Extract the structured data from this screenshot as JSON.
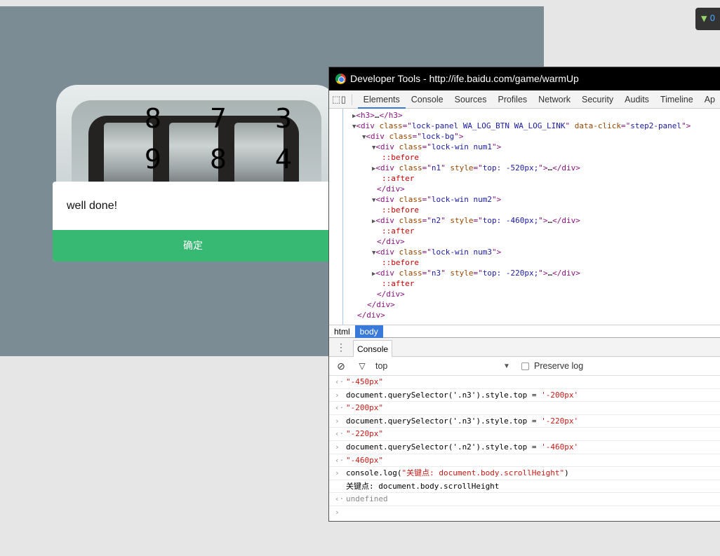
{
  "page": {
    "lock_digits": [
      {
        "prev": "8",
        "current": "9"
      },
      {
        "prev": "7",
        "current": "8"
      },
      {
        "prev": "3",
        "current": "4"
      }
    ],
    "dialog": {
      "message": "well done!",
      "confirm_label": "确定",
      "accent": "#38b973"
    },
    "badge": {
      "count": "0"
    }
  },
  "devtools": {
    "title": "Developer Tools - http://ife.baidu.com/game/warmUp",
    "tabs": [
      "Elements",
      "Console",
      "Sources",
      "Profiles",
      "Network",
      "Security",
      "Audits",
      "Timeline",
      "Ap"
    ],
    "active_tab": "Elements",
    "dom": [
      {
        "indent": 3,
        "tri": "▶",
        "parts": [
          [
            "tg",
            "<h3>"
          ],
          [
            "",
            "…"
          ],
          [
            "tg",
            "</h3>"
          ]
        ]
      },
      {
        "indent": 3,
        "tri": "▼",
        "parts": [
          [
            "tg",
            "<div "
          ],
          [
            "at",
            "class"
          ],
          [
            "tg",
            "=\""
          ],
          [
            "av",
            "lock-panel WA_LOG_BTN WA_LOG_LINK"
          ],
          [
            "tg",
            "\" "
          ],
          [
            "at",
            "data-click"
          ],
          [
            "tg",
            "=\""
          ],
          [
            "av",
            "step2-panel"
          ],
          [
            "tg",
            "\">"
          ]
        ]
      },
      {
        "indent": 5,
        "tri": "▼",
        "parts": [
          [
            "tg",
            "<div "
          ],
          [
            "at",
            "class"
          ],
          [
            "tg",
            "=\""
          ],
          [
            "av",
            "lock-bg"
          ],
          [
            "tg",
            "\">"
          ]
        ]
      },
      {
        "indent": 7,
        "tri": "▼",
        "parts": [
          [
            "tg",
            "<div "
          ],
          [
            "at",
            "class"
          ],
          [
            "tg",
            "=\""
          ],
          [
            "av",
            "lock-win num1"
          ],
          [
            "tg",
            "\">"
          ]
        ]
      },
      {
        "indent": 9,
        "tri": "",
        "parts": [
          [
            "ps",
            "::before"
          ]
        ]
      },
      {
        "indent": 7,
        "tri": "▶",
        "parts": [
          [
            "tg",
            "<div "
          ],
          [
            "at",
            "class"
          ],
          [
            "tg",
            "=\""
          ],
          [
            "av",
            "n1"
          ],
          [
            "tg",
            "\" "
          ],
          [
            "at",
            "style"
          ],
          [
            "tg",
            "=\""
          ],
          [
            "av",
            "top: -520px;"
          ],
          [
            "tg",
            "\">"
          ],
          [
            "",
            "…"
          ],
          [
            "tg",
            "</div>"
          ]
        ]
      },
      {
        "indent": 9,
        "tri": "",
        "parts": [
          [
            "ps",
            "::after"
          ]
        ]
      },
      {
        "indent": 8,
        "tri": "",
        "parts": [
          [
            "tg",
            "</div>"
          ]
        ]
      },
      {
        "indent": 7,
        "tri": "▼",
        "parts": [
          [
            "tg",
            "<div "
          ],
          [
            "at",
            "class"
          ],
          [
            "tg",
            "=\""
          ],
          [
            "av",
            "lock-win num2"
          ],
          [
            "tg",
            "\">"
          ]
        ]
      },
      {
        "indent": 9,
        "tri": "",
        "parts": [
          [
            "ps",
            "::before"
          ]
        ]
      },
      {
        "indent": 7,
        "tri": "▶",
        "parts": [
          [
            "tg",
            "<div "
          ],
          [
            "at",
            "class"
          ],
          [
            "tg",
            "=\""
          ],
          [
            "av",
            "n2"
          ],
          [
            "tg",
            "\" "
          ],
          [
            "at",
            "style"
          ],
          [
            "tg",
            "=\""
          ],
          [
            "av",
            "top: -460px;"
          ],
          [
            "tg",
            "\">"
          ],
          [
            "",
            "…"
          ],
          [
            "tg",
            "</div>"
          ]
        ]
      },
      {
        "indent": 9,
        "tri": "",
        "parts": [
          [
            "ps",
            "::after"
          ]
        ]
      },
      {
        "indent": 8,
        "tri": "",
        "parts": [
          [
            "tg",
            "</div>"
          ]
        ]
      },
      {
        "indent": 7,
        "tri": "▼",
        "parts": [
          [
            "tg",
            "<div "
          ],
          [
            "at",
            "class"
          ],
          [
            "tg",
            "=\""
          ],
          [
            "av",
            "lock-win num3"
          ],
          [
            "tg",
            "\">"
          ]
        ]
      },
      {
        "indent": 9,
        "tri": "",
        "parts": [
          [
            "ps",
            "::before"
          ]
        ]
      },
      {
        "indent": 7,
        "tri": "▶",
        "parts": [
          [
            "tg",
            "<div "
          ],
          [
            "at",
            "class"
          ],
          [
            "tg",
            "=\""
          ],
          [
            "av",
            "n3"
          ],
          [
            "tg",
            "\" "
          ],
          [
            "at",
            "style"
          ],
          [
            "tg",
            "=\""
          ],
          [
            "av",
            "top: -220px;"
          ],
          [
            "tg",
            "\">"
          ],
          [
            "",
            "…"
          ],
          [
            "tg",
            "</div>"
          ]
        ]
      },
      {
        "indent": 9,
        "tri": "",
        "parts": [
          [
            "ps",
            "::after"
          ]
        ]
      },
      {
        "indent": 8,
        "tri": "",
        "parts": [
          [
            "tg",
            "</div>"
          ]
        ]
      },
      {
        "indent": 6,
        "tri": "",
        "parts": [
          [
            "tg",
            "</div>"
          ]
        ]
      },
      {
        "indent": 4,
        "tri": "",
        "parts": [
          [
            "tg",
            "</div>"
          ]
        ]
      }
    ],
    "breadcrumbs": [
      "html",
      "body"
    ],
    "drawer_tab": "Console",
    "console_context": "top",
    "preserve_log_label": "Preserve log",
    "console": [
      {
        "type": "out",
        "parts": [
          [
            "str",
            "\"-450px\""
          ]
        ]
      },
      {
        "type": "in",
        "parts": [
          [
            "",
            "document.querySelector('.n3').style.top = "
          ],
          [
            "str",
            "'-200px'"
          ]
        ]
      },
      {
        "type": "out",
        "parts": [
          [
            "str",
            "\"-200px\""
          ]
        ]
      },
      {
        "type": "in",
        "parts": [
          [
            "",
            "document.querySelector('.n3').style.top = "
          ],
          [
            "str",
            "'-220px'"
          ]
        ]
      },
      {
        "type": "out",
        "parts": [
          [
            "str",
            "\"-220px\""
          ]
        ]
      },
      {
        "type": "in",
        "parts": [
          [
            "",
            "document.querySelector('.n2').style.top = "
          ],
          [
            "str",
            "'-460px'"
          ]
        ]
      },
      {
        "type": "out",
        "parts": [
          [
            "str",
            "\"-460px\""
          ]
        ]
      },
      {
        "type": "in",
        "parts": [
          [
            "",
            "console.log("
          ],
          [
            "str",
            "\"关键点: document.body.scrollHeight\""
          ],
          [
            "",
            ")"
          ]
        ]
      },
      {
        "type": "log",
        "parts": [
          [
            "",
            "关键点: document.body.scrollHeight"
          ]
        ]
      },
      {
        "type": "out",
        "parts": [
          [
            "gray",
            "undefined"
          ]
        ]
      }
    ]
  }
}
